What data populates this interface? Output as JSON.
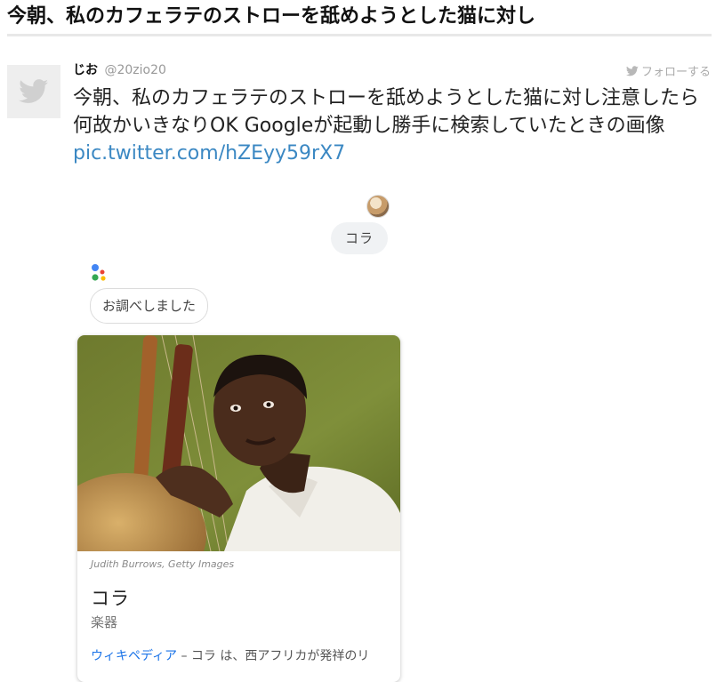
{
  "article": {
    "title": "今朝、私のカフェラテのストローを舐めようとした猫に対し"
  },
  "tweet": {
    "author_name": "じお",
    "author_handle": "@20zio20",
    "follow_label": "フォローする",
    "text": "今朝、私のカフェラテのストローを舐めようとした猫に対し注意したら何故かいきなりOK Googleが起動し勝手に検索していたときの画像 ",
    "link_text": "pic.twitter.com/hZEyy59rX7"
  },
  "assistant": {
    "user_query": "コラ",
    "response": "お調べしました",
    "card": {
      "credit": "Judith Burrows, Getty Images",
      "title": "コラ",
      "subtitle": "楽器",
      "source": "ウィキペディア",
      "description": " – コラ は、西アフリカが発祥のリ"
    }
  },
  "colors": {
    "link": "#3b88c3",
    "google_blue": "#4285F4",
    "google_red": "#EA4335",
    "google_yellow": "#FBBC05",
    "google_green": "#34A853"
  }
}
